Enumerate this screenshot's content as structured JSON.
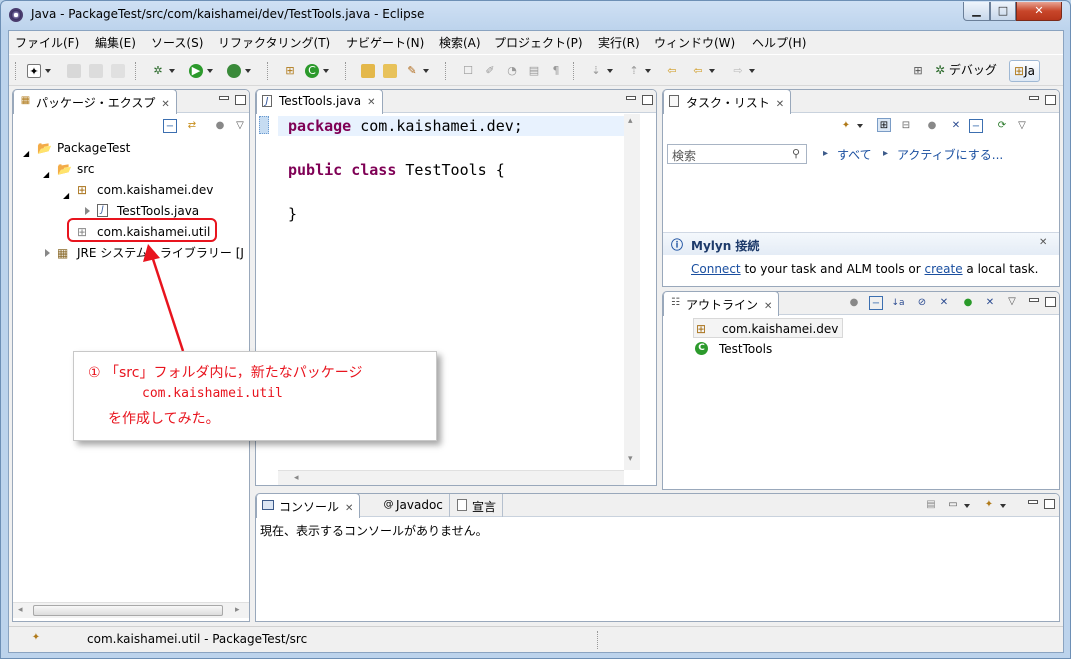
{
  "window": {
    "title": "Java - PackageTest/src/com/kaishamei/dev/TestTools.java - Eclipse",
    "min_label": "▁",
    "max_label": "□",
    "close_label": "✕"
  },
  "menu": [
    "ファイル(F)",
    "編集(E)",
    "ソース(S)",
    "リファクタリング(T)",
    "ナビゲート(N)",
    "検索(A)",
    "プロジェクト(P)",
    "実行(R)",
    "ウィンドウ(W)",
    "ヘルプ(H)"
  ],
  "perspectives": {
    "debug_label": "デバッグ",
    "java_label": "Ja"
  },
  "package_explorer": {
    "tab_label": "パッケージ・エクスプ",
    "tree": [
      {
        "label": "PackageTest",
        "icon": "project-icon"
      },
      {
        "label": "src",
        "icon": "source-folder-icon"
      },
      {
        "label": "com.kaishamei.dev",
        "icon": "package-icon"
      },
      {
        "label": "TestTools.java",
        "icon": "java-file-icon"
      },
      {
        "label": "com.kaishamei.util",
        "icon": "empty-package-icon"
      },
      {
        "label": "JRE システム・ライブラリー [J",
        "icon": "library-icon"
      }
    ]
  },
  "editor": {
    "tab_label": "TestTools.java",
    "lines": {
      "l1_kw": "package",
      "l1_rest": " com.kaishamei.dev;",
      "l2_kw1": "public",
      "l2_kw2": " class",
      "l2_rest": " TestTools {",
      "l3": "}"
    }
  },
  "task_list": {
    "tab_label": "タスク・リスト",
    "search_placeholder": "検索",
    "filter_all": "すべて",
    "filter_active": "アクティブにする..."
  },
  "mylyn": {
    "title": "Mylyn 接続",
    "connect_link": "Connect",
    "text_middle": " to your task and ALM tools or ",
    "create_link": "create",
    "text_end": " a local task."
  },
  "outline": {
    "tab_label": "アウトライン",
    "items": [
      {
        "label": "com.kaishamei.dev",
        "icon": "package-icon"
      },
      {
        "label": "TestTools",
        "icon": "class-icon"
      }
    ]
  },
  "console": {
    "tab_label": "コンソール",
    "javadoc_tab": "Javadoc",
    "declaration_tab": "宣言",
    "message": "現在、表示するコンソールがありません。"
  },
  "status": {
    "text": "com.kaishamei.util - PackageTest/src"
  },
  "annotation": {
    "line1": "① 「src」フォルダ内に，新たなパッケージ",
    "line2": "com.kaishamei.util",
    "line3": "を作成してみた。",
    "color": "#e8141e"
  }
}
